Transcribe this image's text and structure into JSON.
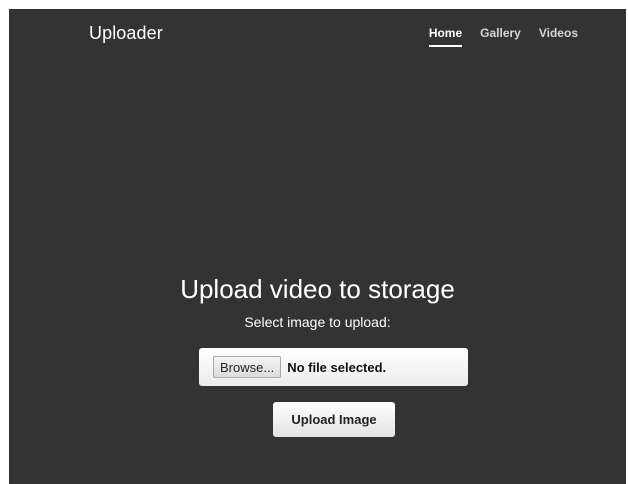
{
  "header": {
    "brand": "Uploader",
    "nav": [
      {
        "label": "Home",
        "active": true
      },
      {
        "label": "Gallery",
        "active": false
      },
      {
        "label": "Videos",
        "active": false
      }
    ]
  },
  "main": {
    "title": "Upload video to storage",
    "subtitle": "Select image to upload:",
    "file_input": {
      "browse_label": "Browse...",
      "status": "No file selected."
    },
    "upload_button_label": "Upload Image"
  },
  "colors": {
    "background": "#333333",
    "text": "#ffffff",
    "nav_inactive": "#d6d6d6"
  }
}
